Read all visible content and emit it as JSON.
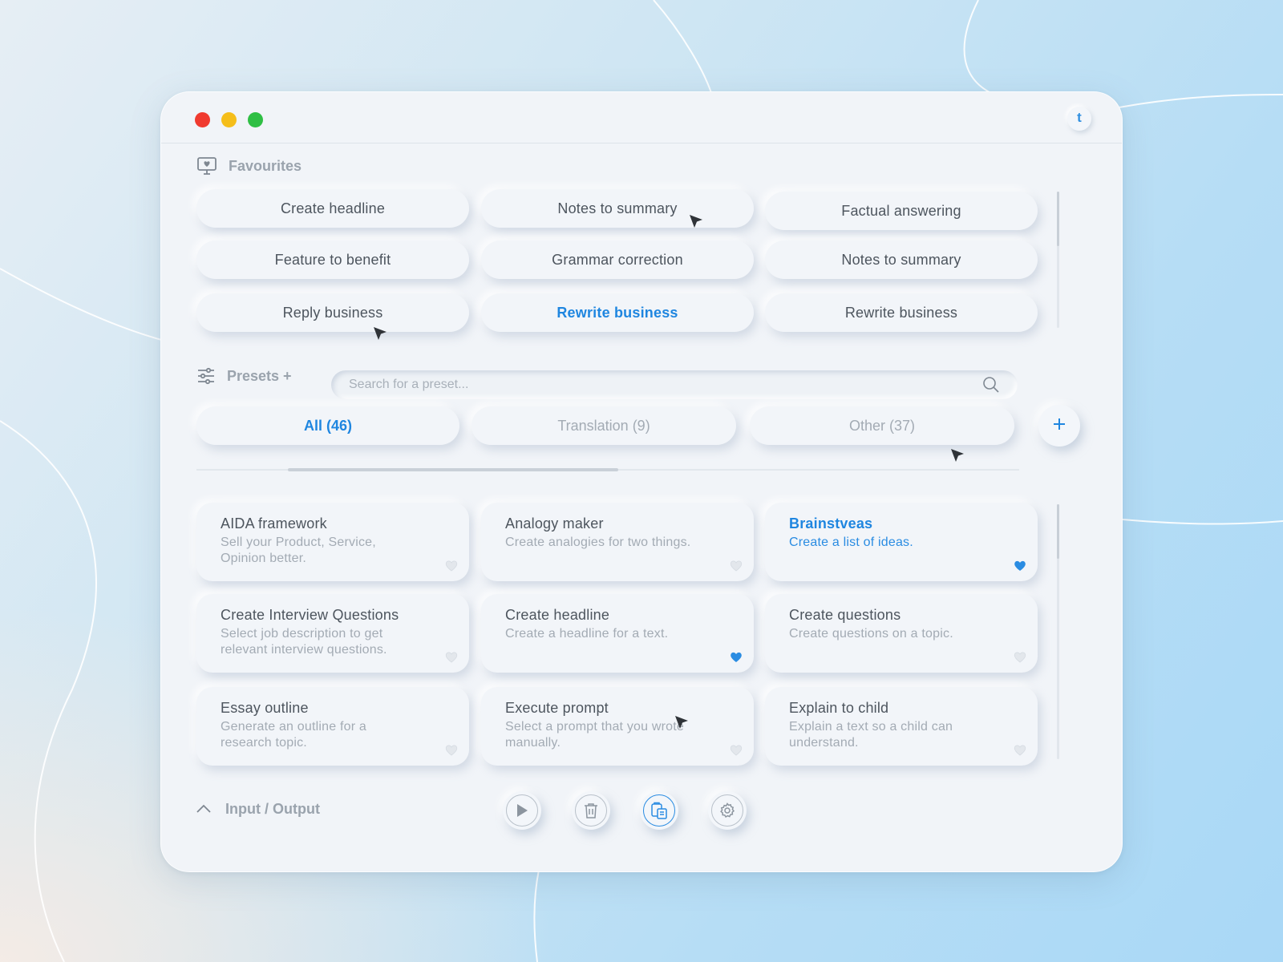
{
  "window": {
    "avatar_letter": "t",
    "accent_color": "#1f86e0"
  },
  "favourites": {
    "title": "Favourites",
    "icon": "monitor-heart-icon",
    "items": [
      {
        "label": "Create headline",
        "active": false
      },
      {
        "label": "Notes to summary",
        "active": false
      },
      {
        "label": "Factual answering",
        "active": false
      },
      {
        "label": "Feature to benefit",
        "active": false
      },
      {
        "label": "Grammar correction",
        "active": false
      },
      {
        "label": "Notes to summary",
        "active": false
      },
      {
        "label": "Reply business",
        "active": false
      },
      {
        "label": "Rewrite business",
        "active": true
      },
      {
        "label": "Rewrite business",
        "active": false
      }
    ]
  },
  "presets": {
    "title": "Presets +",
    "icon": "sliders-icon",
    "search_placeholder": "Search for a preset...",
    "search_value": "",
    "tabs": [
      {
        "label": "All (46)",
        "active": true
      },
      {
        "label": "Translation (9)",
        "active": false
      },
      {
        "label": "Other (37)",
        "active": false
      }
    ],
    "add_icon": "plus-icon",
    "cards": [
      {
        "title": "AIDA framework",
        "desc": "Sell your Product, Service, Opinion better.",
        "favourite": false,
        "active": false
      },
      {
        "title": "Analogy maker",
        "desc": "Create analogies for two things.",
        "favourite": false,
        "active": false
      },
      {
        "title": "Brainstveas",
        "desc": "Create a list of ideas.",
        "favourite": true,
        "active": true
      },
      {
        "title": "Create Interview Questions",
        "desc": "Select job description to get relevant interview questions.",
        "favourite": false,
        "active": false
      },
      {
        "title": "Create headline",
        "desc": "Create a headline for a text.",
        "favourite": true,
        "active": false
      },
      {
        "title": "Create questions",
        "desc": "Create questions on a topic.",
        "favourite": false,
        "active": false
      },
      {
        "title": "Essay outline",
        "desc": "Generate an outline for a research topic.",
        "favourite": false,
        "active": false
      },
      {
        "title": "Execute prompt",
        "desc": "Select a prompt that you wrote manually.",
        "favourite": false,
        "active": false
      },
      {
        "title": "Explain to child",
        "desc": "Explain a text so a child can understand.",
        "favourite": false,
        "active": false
      }
    ]
  },
  "io": {
    "label": "Input / Output",
    "icon": "chevron-up-icon",
    "actions": [
      {
        "name": "play-button",
        "icon": "play-icon",
        "primary": false
      },
      {
        "name": "delete-button",
        "icon": "trash-icon",
        "primary": false
      },
      {
        "name": "paste-button",
        "icon": "clipboard-icon",
        "primary": true
      },
      {
        "name": "settings-button",
        "icon": "gear-icon",
        "primary": false
      }
    ]
  }
}
